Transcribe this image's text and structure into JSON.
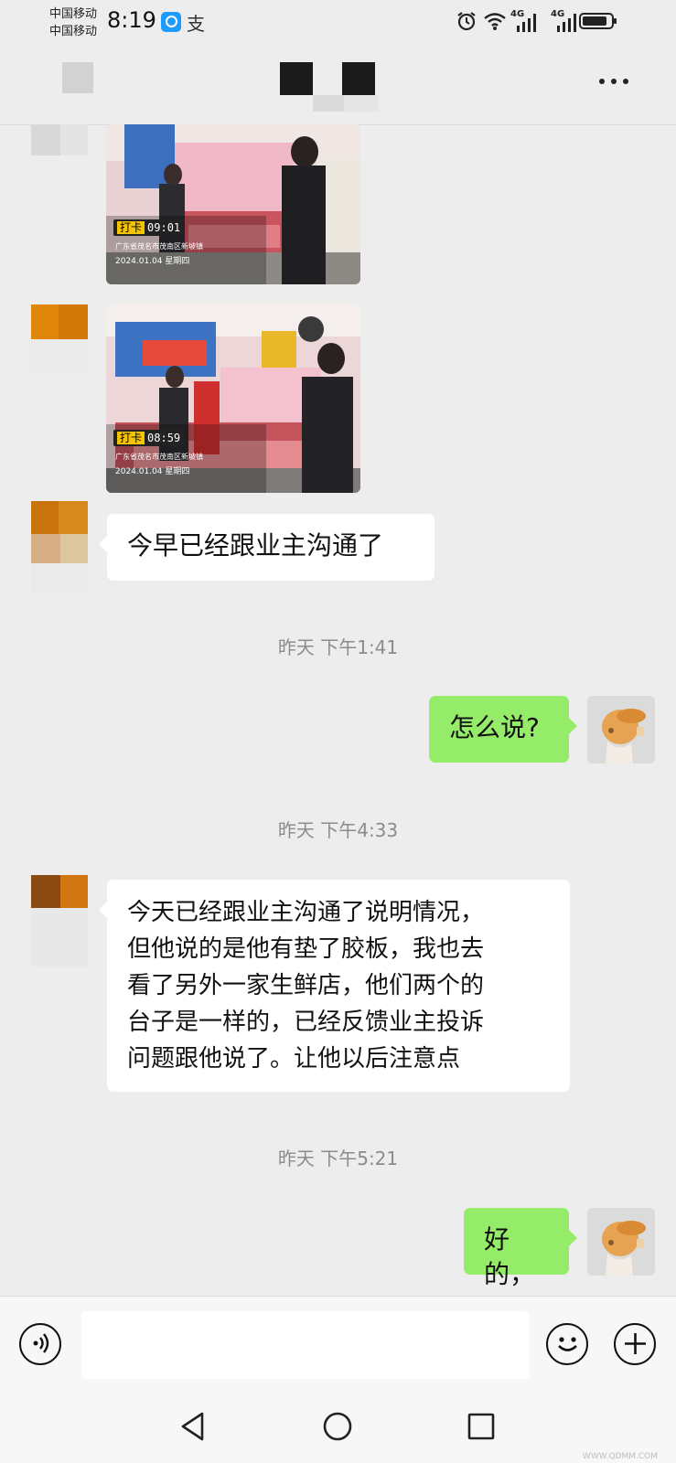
{
  "status_bar": {
    "carrier_1": "中国移动",
    "carrier_2": "中国移动",
    "time": "8:19",
    "app_icon_1": "search-app-icon",
    "app_icon_2": "alipay-icon",
    "alipay_glyph": "支",
    "net_1": "4G",
    "net_2": "4G",
    "icons": [
      "alarm-icon",
      "wifi-icon",
      "signal-icon",
      "signal-icon",
      "battery-icon"
    ]
  },
  "header": {
    "back": "blurred-avatar",
    "title": "",
    "more_icon": "more-dots-icon"
  },
  "messages": [
    {
      "type": "image",
      "side": "in",
      "badge_label": "打卡",
      "badge_time": "09:01",
      "location": "广东省茂名市茂南区新坡镇",
      "date": "2024.01.04 星期四"
    },
    {
      "type": "image",
      "side": "in",
      "badge_label": "打卡",
      "badge_time": "08:59",
      "location": "广东省茂名市茂南区新坡镇",
      "date": "2024.01.04 星期四"
    },
    {
      "type": "text",
      "side": "in",
      "text": "今早已经跟业主沟通了"
    },
    {
      "type": "time",
      "text": "昨天 下午1:41"
    },
    {
      "type": "text",
      "side": "out",
      "text": "怎么说?"
    },
    {
      "type": "time",
      "text": "昨天 下午4:33"
    },
    {
      "type": "text",
      "side": "in",
      "lines": [
        "今天已经跟业主沟通了说明情况，",
        "但他说的是他有垫了胶板，我也去",
        "看了另外一家生鲜店，他们两个的",
        "台子是一样的，已经反馈业主投诉",
        "问题跟他说了。让他以后注意点"
      ]
    },
    {
      "type": "time",
      "text": "昨天 下午5:21"
    },
    {
      "type": "text",
      "side": "out",
      "text": "好的，"
    }
  ],
  "input_bar": {
    "voice_icon": "voice-icon",
    "emoji_icon": "emoji-icon",
    "plus_icon": "plus-icon",
    "placeholder": ""
  },
  "system_nav": [
    "back-triangle-icon",
    "home-circle-icon",
    "recents-square-icon"
  ],
  "watermark": "WWW.QDMM.COM",
  "colors": {
    "background": "#ededed",
    "outgoing_bubble": "#95ec69",
    "incoming_bubble": "#ffffff"
  }
}
